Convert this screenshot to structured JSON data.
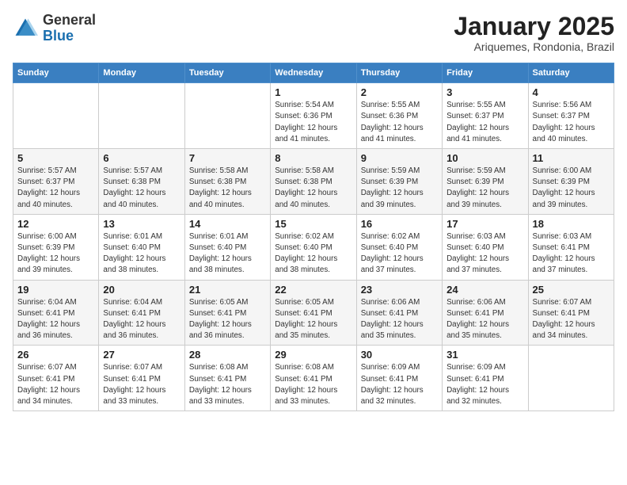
{
  "header": {
    "logo_general": "General",
    "logo_blue": "Blue",
    "month_title": "January 2025",
    "location": "Ariquemes, Rondonia, Brazil"
  },
  "weekdays": [
    "Sunday",
    "Monday",
    "Tuesday",
    "Wednesday",
    "Thursday",
    "Friday",
    "Saturday"
  ],
  "weeks": [
    [
      {
        "day": "",
        "info": ""
      },
      {
        "day": "",
        "info": ""
      },
      {
        "day": "",
        "info": ""
      },
      {
        "day": "1",
        "info": "Sunrise: 5:54 AM\nSunset: 6:36 PM\nDaylight: 12 hours\nand 41 minutes."
      },
      {
        "day": "2",
        "info": "Sunrise: 5:55 AM\nSunset: 6:36 PM\nDaylight: 12 hours\nand 41 minutes."
      },
      {
        "day": "3",
        "info": "Sunrise: 5:55 AM\nSunset: 6:37 PM\nDaylight: 12 hours\nand 41 minutes."
      },
      {
        "day": "4",
        "info": "Sunrise: 5:56 AM\nSunset: 6:37 PM\nDaylight: 12 hours\nand 40 minutes."
      }
    ],
    [
      {
        "day": "5",
        "info": "Sunrise: 5:57 AM\nSunset: 6:37 PM\nDaylight: 12 hours\nand 40 minutes."
      },
      {
        "day": "6",
        "info": "Sunrise: 5:57 AM\nSunset: 6:38 PM\nDaylight: 12 hours\nand 40 minutes."
      },
      {
        "day": "7",
        "info": "Sunrise: 5:58 AM\nSunset: 6:38 PM\nDaylight: 12 hours\nand 40 minutes."
      },
      {
        "day": "8",
        "info": "Sunrise: 5:58 AM\nSunset: 6:38 PM\nDaylight: 12 hours\nand 40 minutes."
      },
      {
        "day": "9",
        "info": "Sunrise: 5:59 AM\nSunset: 6:39 PM\nDaylight: 12 hours\nand 39 minutes."
      },
      {
        "day": "10",
        "info": "Sunrise: 5:59 AM\nSunset: 6:39 PM\nDaylight: 12 hours\nand 39 minutes."
      },
      {
        "day": "11",
        "info": "Sunrise: 6:00 AM\nSunset: 6:39 PM\nDaylight: 12 hours\nand 39 minutes."
      }
    ],
    [
      {
        "day": "12",
        "info": "Sunrise: 6:00 AM\nSunset: 6:39 PM\nDaylight: 12 hours\nand 39 minutes."
      },
      {
        "day": "13",
        "info": "Sunrise: 6:01 AM\nSunset: 6:40 PM\nDaylight: 12 hours\nand 38 minutes."
      },
      {
        "day": "14",
        "info": "Sunrise: 6:01 AM\nSunset: 6:40 PM\nDaylight: 12 hours\nand 38 minutes."
      },
      {
        "day": "15",
        "info": "Sunrise: 6:02 AM\nSunset: 6:40 PM\nDaylight: 12 hours\nand 38 minutes."
      },
      {
        "day": "16",
        "info": "Sunrise: 6:02 AM\nSunset: 6:40 PM\nDaylight: 12 hours\nand 37 minutes."
      },
      {
        "day": "17",
        "info": "Sunrise: 6:03 AM\nSunset: 6:40 PM\nDaylight: 12 hours\nand 37 minutes."
      },
      {
        "day": "18",
        "info": "Sunrise: 6:03 AM\nSunset: 6:41 PM\nDaylight: 12 hours\nand 37 minutes."
      }
    ],
    [
      {
        "day": "19",
        "info": "Sunrise: 6:04 AM\nSunset: 6:41 PM\nDaylight: 12 hours\nand 36 minutes."
      },
      {
        "day": "20",
        "info": "Sunrise: 6:04 AM\nSunset: 6:41 PM\nDaylight: 12 hours\nand 36 minutes."
      },
      {
        "day": "21",
        "info": "Sunrise: 6:05 AM\nSunset: 6:41 PM\nDaylight: 12 hours\nand 36 minutes."
      },
      {
        "day": "22",
        "info": "Sunrise: 6:05 AM\nSunset: 6:41 PM\nDaylight: 12 hours\nand 35 minutes."
      },
      {
        "day": "23",
        "info": "Sunrise: 6:06 AM\nSunset: 6:41 PM\nDaylight: 12 hours\nand 35 minutes."
      },
      {
        "day": "24",
        "info": "Sunrise: 6:06 AM\nSunset: 6:41 PM\nDaylight: 12 hours\nand 35 minutes."
      },
      {
        "day": "25",
        "info": "Sunrise: 6:07 AM\nSunset: 6:41 PM\nDaylight: 12 hours\nand 34 minutes."
      }
    ],
    [
      {
        "day": "26",
        "info": "Sunrise: 6:07 AM\nSunset: 6:41 PM\nDaylight: 12 hours\nand 34 minutes."
      },
      {
        "day": "27",
        "info": "Sunrise: 6:07 AM\nSunset: 6:41 PM\nDaylight: 12 hours\nand 33 minutes."
      },
      {
        "day": "28",
        "info": "Sunrise: 6:08 AM\nSunset: 6:41 PM\nDaylight: 12 hours\nand 33 minutes."
      },
      {
        "day": "29",
        "info": "Sunrise: 6:08 AM\nSunset: 6:41 PM\nDaylight: 12 hours\nand 33 minutes."
      },
      {
        "day": "30",
        "info": "Sunrise: 6:09 AM\nSunset: 6:41 PM\nDaylight: 12 hours\nand 32 minutes."
      },
      {
        "day": "31",
        "info": "Sunrise: 6:09 AM\nSunset: 6:41 PM\nDaylight: 12 hours\nand 32 minutes."
      },
      {
        "day": "",
        "info": ""
      }
    ]
  ]
}
